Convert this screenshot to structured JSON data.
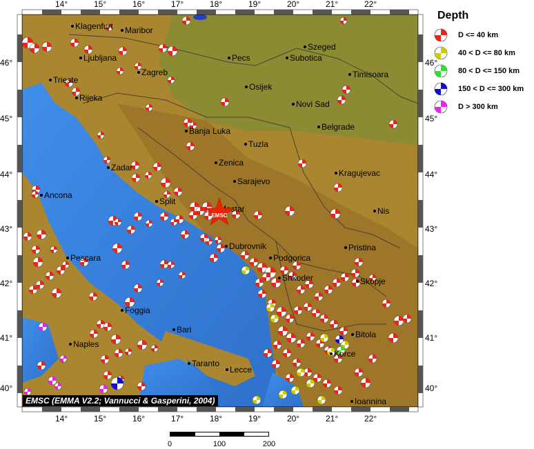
{
  "legend": {
    "title": "Depth",
    "items": [
      {
        "label": "D <= 40 km",
        "color": "#e8261a"
      },
      {
        "label": "40 < D <= 80 km",
        "color": "#cccc00"
      },
      {
        "label": "80 < D <= 150 km",
        "color": "#33dd33"
      },
      {
        "label": "150 < D <= 300 km",
        "color": "#1010cc"
      },
      {
        "label": "D > 300 km",
        "color": "#ee22ee"
      }
    ]
  },
  "lon_ticks": [
    "14°",
    "15°",
    "16°",
    "17°",
    "18°",
    "19°",
    "20°",
    "21°",
    "22°"
  ],
  "lat_ticks": [
    "46°",
    "45°",
    "44°",
    "43°",
    "42°",
    "41°",
    "40°"
  ],
  "cities": [
    {
      "name": "Klagenfurt"
    },
    {
      "name": "Maribor"
    },
    {
      "name": "Ljubljana"
    },
    {
      "name": "Zagreb"
    },
    {
      "name": "Pecs"
    },
    {
      "name": "Szeged"
    },
    {
      "name": "Subotica"
    },
    {
      "name": "Timisoara"
    },
    {
      "name": "Trieste"
    },
    {
      "name": "Rijeka"
    },
    {
      "name": "Osijek"
    },
    {
      "name": "Novi Sad"
    },
    {
      "name": "Banja Luka"
    },
    {
      "name": "Belgrade"
    },
    {
      "name": "Tuzla"
    },
    {
      "name": "Zenica"
    },
    {
      "name": "Zadar"
    },
    {
      "name": "Sarajevo"
    },
    {
      "name": "Kragujevac"
    },
    {
      "name": "Ancona"
    },
    {
      "name": "Split"
    },
    {
      "name": "Mostar"
    },
    {
      "name": "Nis"
    },
    {
      "name": "Dubrovnik"
    },
    {
      "name": "Pristina"
    },
    {
      "name": "Pescara"
    },
    {
      "name": "Podgorica"
    },
    {
      "name": "Skopje"
    },
    {
      "name": "Shkoder"
    },
    {
      "name": "Foggia"
    },
    {
      "name": "Bari"
    },
    {
      "name": "Bitola"
    },
    {
      "name": "Naples"
    },
    {
      "name": "Taranto"
    },
    {
      "name": "Lecce"
    },
    {
      "name": "Korce"
    },
    {
      "name": "Ioannina"
    }
  ],
  "emsc_marker": "EMSC",
  "credit": "EMSC (EMMA V2.2; Vannucci & Gasperini, 2004)",
  "scale": {
    "labels": [
      "0",
      "100",
      "200"
    ]
  }
}
